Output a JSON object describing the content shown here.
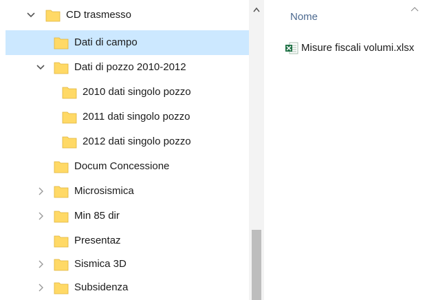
{
  "nav_tree": {
    "items": [
      {
        "label": "CD trasmesso",
        "chevron": "chevron-down-icon",
        "selected": false
      },
      {
        "label": "Dati di campo",
        "chevron": "",
        "selected": true
      },
      {
        "label": "Dati di pozzo 2010-2012",
        "chevron": "chevron-down-icon",
        "selected": false
      },
      {
        "label": "2010 dati singolo pozzo",
        "chevron": "",
        "selected": false
      },
      {
        "label": "2011 dati singolo pozzo",
        "chevron": "",
        "selected": false
      },
      {
        "label": "2012 dati singolo pozzo",
        "chevron": "",
        "selected": false
      },
      {
        "label": "Docum Concessione",
        "chevron": "",
        "selected": false
      },
      {
        "label": "Microsismica",
        "chevron": "chevron-right-icon",
        "selected": false
      },
      {
        "label": "Min 85 dir",
        "chevron": "chevron-right-icon",
        "selected": false
      },
      {
        "label": "Presentaz",
        "chevron": "",
        "selected": false
      },
      {
        "label": "Sismica 3D",
        "chevron": "chevron-right-icon",
        "selected": false
      },
      {
        "label": "Subsidenza",
        "chevron": "chevron-right-icon",
        "selected": false
      }
    ]
  },
  "file_list": {
    "column_header": "Nome",
    "files": [
      {
        "name": "Misure fiscali volumi.xlsx",
        "icon": "excel-file-icon"
      }
    ]
  },
  "colors": {
    "selected_row": "#cce8ff",
    "folder_yellow": "#ffd966",
    "header_text": "#4d6a90",
    "excel_green": "#1e7145"
  }
}
